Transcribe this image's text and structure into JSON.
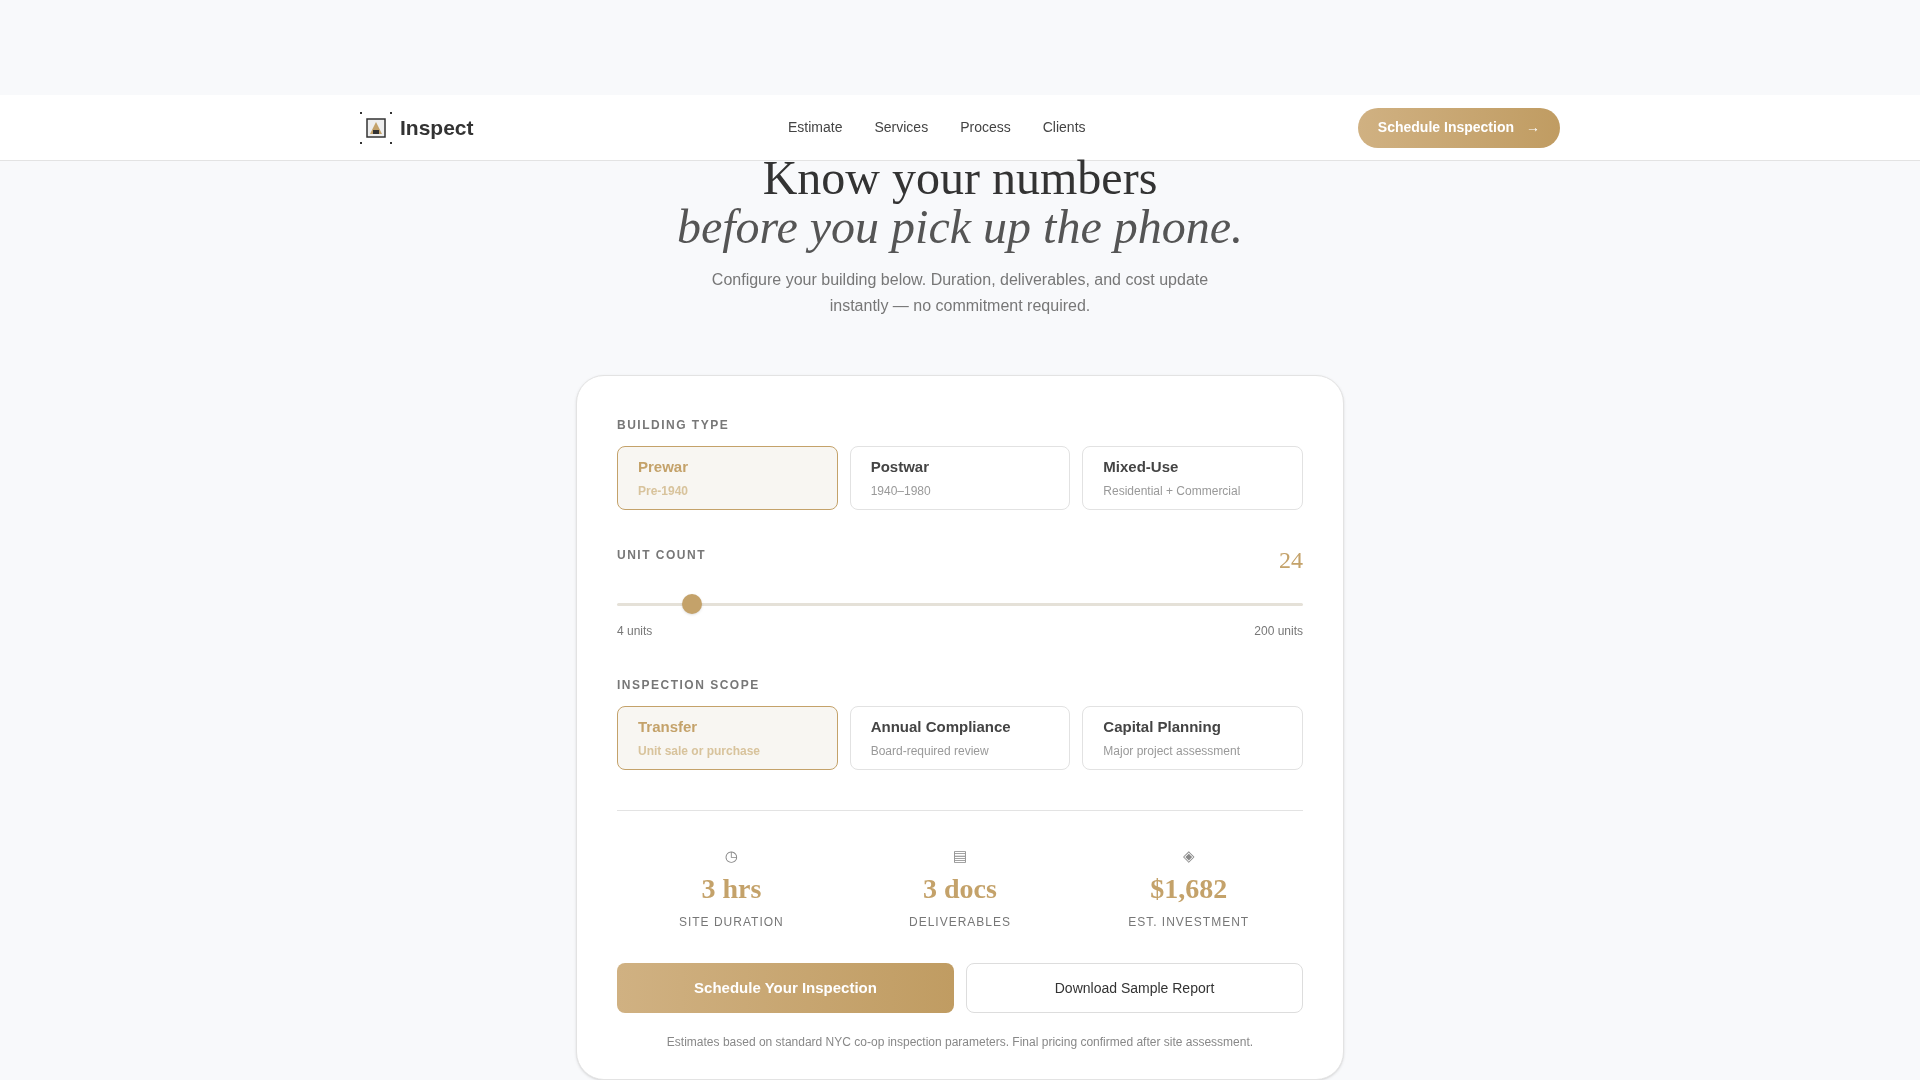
{
  "nav": {
    "brand": "Inspect",
    "links": [
      "Estimate",
      "Services",
      "Process",
      "Clients"
    ],
    "cta": "Schedule Inspection",
    "cta_arrow": "→"
  },
  "hero": {
    "title": "Know your numbers",
    "title_italic": "before you pick up the phone.",
    "subtitle": "Configure your building below. Duration, deliverables, and cost update instantly — no commitment required."
  },
  "building_type": {
    "label": "BUILDING TYPE",
    "options": [
      {
        "title": "Prewar",
        "subtitle": "Pre-1940",
        "selected": true
      },
      {
        "title": "Postwar",
        "subtitle": "1940–1980",
        "selected": false
      },
      {
        "title": "Mixed-Use",
        "subtitle": "Residential + Commercial",
        "selected": false
      }
    ]
  },
  "unit_count": {
    "label": "UNIT COUNT",
    "value": "24",
    "level": 0.11,
    "min_label": "4 units",
    "max_label": "200 units"
  },
  "inspection_scope": {
    "label": "INSPECTION SCOPE",
    "options": [
      {
        "title": "Transfer",
        "subtitle": "Unit sale or purchase",
        "selected": true
      },
      {
        "title": "Annual Compliance",
        "subtitle": "Board-required review",
        "selected": false
      },
      {
        "title": "Capital Planning",
        "subtitle": "Major project assessment",
        "selected": false
      }
    ]
  },
  "results": [
    {
      "icon": "◷",
      "value": "3 hrs",
      "label": "SITE DURATION"
    },
    {
      "icon": "▤",
      "value": "3 docs",
      "label": "DELIVERABLES"
    },
    {
      "icon": "◈",
      "value": "$1,682",
      "label": "EST. INVESTMENT"
    }
  ],
  "actions": {
    "primary": "Schedule Your Inspection",
    "secondary": "Download Sample Report"
  },
  "footnote": "Estimates based on standard NYC co-op inspection parameters. Final pricing confirmed after site assessment."
}
